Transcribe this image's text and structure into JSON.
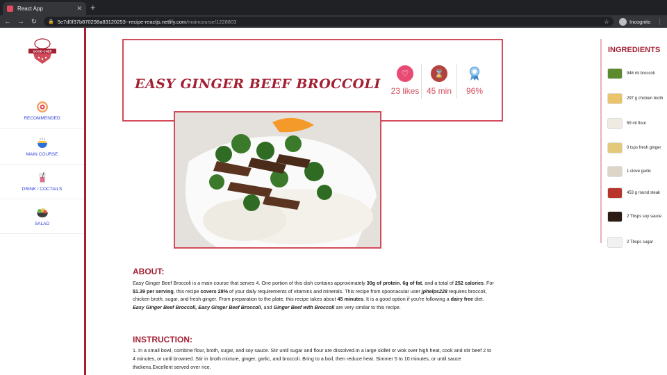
{
  "browser": {
    "tab_title": "React App",
    "tab_close": "✕",
    "new_tab": "+",
    "url_host": "5e7d0f37b870298a83120253--recipe-reactjs.netlify.com",
    "url_path": "/maincourse/1228803",
    "profile_label": "Incognito"
  },
  "sidebar": {
    "logo_text": "GOOD CHEF",
    "items": [
      {
        "label": "RECOMMENDED",
        "icon": "target-icon"
      },
      {
        "label": "MAIN COURSE",
        "icon": "bowl-icon"
      },
      {
        "label": "DRINK / COCTAILS",
        "icon": "drink-icon"
      },
      {
        "label": "SALAD",
        "icon": "salad-icon"
      }
    ]
  },
  "recipe": {
    "title": "EASY GINGER BEEF BROCCOLI",
    "likes": "23 likes",
    "time": "45 min",
    "score": "96%"
  },
  "about": {
    "heading": "ABOUT:",
    "parts": [
      {
        "t": "Easy Ginger Beef Broccoli is a main course that serves 4. One portion of this dish contains approximately ",
        "s": ""
      },
      {
        "t": "30g of protein",
        "s": "b"
      },
      {
        "t": ", ",
        "s": ""
      },
      {
        "t": "6g of fat",
        "s": "b"
      },
      {
        "t": ", and a total of ",
        "s": ""
      },
      {
        "t": "252 calories",
        "s": "b"
      },
      {
        "t": ". For ",
        "s": ""
      },
      {
        "t": "$1.39 per serving",
        "s": "b"
      },
      {
        "t": ", this recipe ",
        "s": ""
      },
      {
        "t": "covers 28%",
        "s": "b"
      },
      {
        "t": " of your daily requirements of vitamins and minerals. This recipe from spoonacular user ",
        "s": ""
      },
      {
        "t": "jphelps228",
        "s": "i"
      },
      {
        "t": " requires broccoli, chicken broth, sugar, and fresh ginger. From preparation to the plate, this recipe takes about ",
        "s": ""
      },
      {
        "t": "45 minutes",
        "s": "b"
      },
      {
        "t": ". It is a good option if you're following a ",
        "s": ""
      },
      {
        "t": "dairy free",
        "s": "b"
      },
      {
        "t": " diet. ",
        "s": ""
      },
      {
        "t": "Easy Ginger Beef Broccoli, Easy Ginger Beef Broccoli",
        "s": "i"
      },
      {
        "t": ", and ",
        "s": ""
      },
      {
        "t": "Ginger Beef with Broccoli",
        "s": "i"
      },
      {
        "t": " are very similar to this recipe.",
        "s": ""
      }
    ]
  },
  "instruction": {
    "heading": "INSTRUCTION:",
    "text": "1. In a small bowl, combine flour, broth, sugar, and soy sauce. Stir until sugar and flour are dissolved.In a large skillet or wok over high heat, cook and stir beef 2 to 4 minutes, or until browned. Stir in broth mixture, ginger, garlic, and broccoli. Bring to a boil, then reduce heat. Simmer 5 to 10 minutes, or until sauce thickens.Excellent served over rice."
  },
  "ingredients": {
    "heading": "INGREDIENTS",
    "items": [
      {
        "text": "946 ml broccoli",
        "color": "#5e8a2e"
      },
      {
        "text": "297 g chicken broth",
        "color": "#e9c46a"
      },
      {
        "text": "59 ml flour",
        "color": "#efeae2"
      },
      {
        "text": "0 tsps fresh ginger",
        "color": "#e3c97a"
      },
      {
        "text": "1 clove garlic",
        "color": "#ddd6c8"
      },
      {
        "text": "453 g round steak",
        "color": "#b9342a"
      },
      {
        "text": "2 Tbsps soy sauce",
        "color": "#2b1b12"
      },
      {
        "text": "2 Tbsps sugar",
        "color": "#f1f1f1"
      }
    ]
  },
  "colors": {
    "brand": "#a32033",
    "accent": "#d24b5a",
    "nav_text": "#2b3fd6"
  }
}
